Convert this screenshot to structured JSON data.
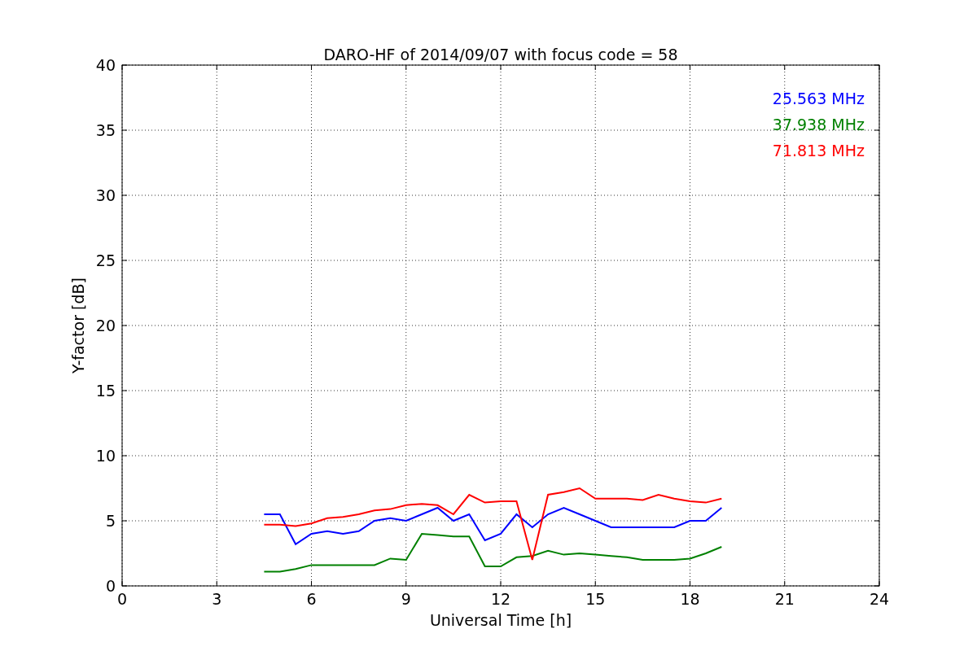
{
  "chart_data": {
    "type": "line",
    "title": "DARO-HF of 2014/09/07 with focus code = 58",
    "xlabel": "Universal Time [h]",
    "ylabel": "Y-factor [dB]",
    "x": [
      4.5,
      5,
      5.5,
      6,
      6.5,
      7,
      7.5,
      8,
      8.5,
      9,
      9.5,
      10,
      10.5,
      11,
      11.5,
      12,
      12.5,
      13,
      13.5,
      14,
      14.5,
      15,
      15.5,
      16,
      16.5,
      17,
      17.5,
      18,
      18.5,
      19
    ],
    "series": [
      {
        "name": "25.563 MHz",
        "color": "#0000ff",
        "values": [
          5.5,
          5.5,
          3.2,
          4,
          4.2,
          4,
          4.2,
          5,
          5.2,
          5,
          5.5,
          6,
          5,
          5.5,
          3.5,
          4,
          5.5,
          4.5,
          5.5,
          6,
          5.5,
          5,
          4.5,
          4.5,
          4.5,
          4.5,
          4.5,
          5,
          5,
          6
        ]
      },
      {
        "name": "37.938 MHz",
        "color": "#008000",
        "values": [
          1.1,
          1.1,
          1.3,
          1.6,
          1.6,
          1.6,
          1.6,
          1.6,
          2.1,
          2,
          4,
          3.9,
          3.8,
          3.8,
          1.5,
          1.5,
          2.2,
          2.3,
          2.7,
          2.4,
          2.5,
          2.4,
          2.3,
          2.2,
          2,
          2,
          2,
          2.1,
          2.5,
          3
        ]
      },
      {
        "name": "71.813 MHz",
        "color": "#ff0000",
        "values": [
          4.7,
          4.7,
          4.6,
          4.8,
          5.2,
          5.3,
          5.5,
          5.8,
          5.9,
          6.2,
          6.3,
          6.2,
          5.5,
          7,
          6.4,
          6.5,
          6.5,
          2,
          7,
          7.2,
          7.5,
          6.7,
          6.7,
          6.7,
          6.6,
          7,
          6.7,
          6.5,
          6.4,
          6.7
        ]
      }
    ],
    "xlim": [
      0,
      24
    ],
    "ylim": [
      0,
      40
    ],
    "xticks": [
      0,
      3,
      6,
      9,
      12,
      15,
      18,
      21,
      24
    ],
    "yticks": [
      0,
      5,
      10,
      15,
      20,
      25,
      30,
      35,
      40
    ],
    "grid": true
  }
}
